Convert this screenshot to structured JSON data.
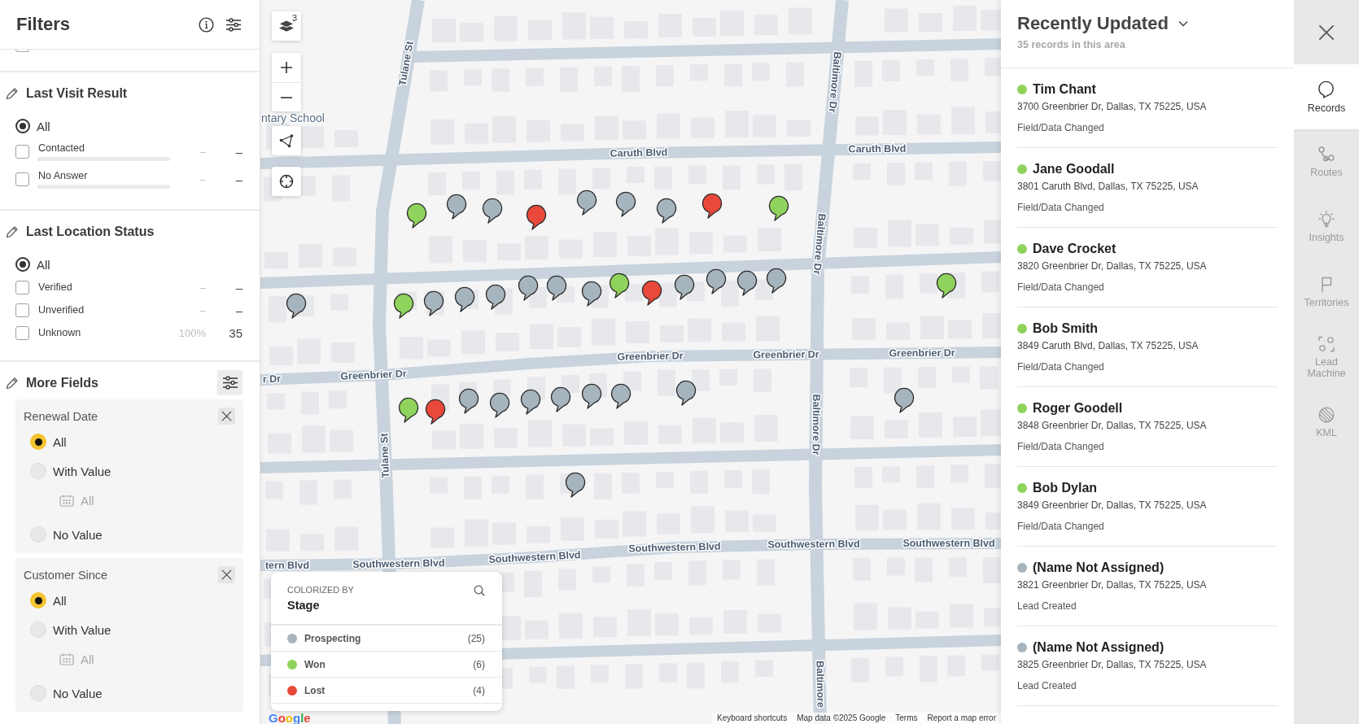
{
  "filters": {
    "title": "Filters",
    "scrolled_checkbox": {
      "checked": false
    },
    "sections": [
      {
        "title": "Last Visit Result",
        "options": [
          {
            "kind": "radio",
            "label": "All",
            "selected": true
          },
          {
            "kind": "checkbox",
            "label": "Contacted",
            "checked": false,
            "level": 0,
            "percent": "–",
            "count": "–"
          },
          {
            "kind": "checkbox",
            "label": "No Answer",
            "checked": false,
            "level": 0,
            "percent": "–",
            "count": "–"
          }
        ]
      },
      {
        "title": "Last Location Status",
        "options": [
          {
            "kind": "radio",
            "label": "All",
            "selected": true
          },
          {
            "kind": "checkbox",
            "label": "Verified",
            "checked": false,
            "percent": "–",
            "count": "–"
          },
          {
            "kind": "checkbox",
            "label": "Unverified",
            "checked": false,
            "percent": "–",
            "count": "–"
          },
          {
            "kind": "checkbox",
            "label": "Unknown",
            "checked": false,
            "percent": "100%",
            "count": "35"
          }
        ]
      }
    ],
    "more_fields": {
      "title": "More Fields",
      "fields": [
        {
          "title": "Renewal Date",
          "options": [
            {
              "label": "All",
              "selected": true
            },
            {
              "label": "With Value",
              "selected": false,
              "date_range": "All"
            },
            {
              "label": "No Value",
              "selected": false
            }
          ]
        },
        {
          "title": "Customer Since",
          "options": [
            {
              "label": "All",
              "selected": true
            },
            {
              "label": "With Value",
              "selected": false,
              "date_range": "All"
            },
            {
              "label": "No Value",
              "selected": false
            }
          ]
        }
      ]
    }
  },
  "map": {
    "layers_count": "3",
    "street_labels": [
      {
        "text": "Tulane St",
        "kind": "street"
      },
      {
        "text": "ntary School",
        "kind": "place"
      },
      {
        "text": "Caruth Blvd",
        "kind": "street"
      },
      {
        "text": "Caruth Blvd",
        "kind": "street"
      },
      {
        "text": "Baltimore Dr",
        "kind": "street"
      },
      {
        "text": "Baltimore Dr",
        "kind": "street"
      },
      {
        "text": "r Dr",
        "kind": "street"
      },
      {
        "text": "Greenbrier Dr",
        "kind": "street"
      },
      {
        "text": "Greenbrier Dr",
        "kind": "street"
      },
      {
        "text": "Greenbrier Dr",
        "kind": "street"
      },
      {
        "text": "Greenbrier Dr",
        "kind": "street"
      },
      {
        "text": "Baltimore Dr",
        "kind": "street"
      },
      {
        "text": "Tulane St",
        "kind": "street"
      },
      {
        "text": "tern Blvd",
        "kind": "street"
      },
      {
        "text": "Southwestern Blvd",
        "kind": "street"
      },
      {
        "text": "Southwestern Blvd",
        "kind": "street"
      },
      {
        "text": "Southwestern Blvd",
        "kind": "street"
      },
      {
        "text": "Southwestern Blvd",
        "kind": "street"
      },
      {
        "text": "Southwestern Blvd",
        "kind": "street"
      },
      {
        "text": "Baltimore",
        "kind": "street"
      }
    ],
    "pins": [
      {
        "color": "#8fd35c"
      },
      {
        "color": "#a6b4be"
      },
      {
        "color": "#a6b4be"
      },
      {
        "color": "#e8493b"
      },
      {
        "color": "#a6b4be"
      },
      {
        "color": "#a6b4be"
      },
      {
        "color": "#a6b4be"
      },
      {
        "color": "#e8493b"
      },
      {
        "color": "#8fd35c"
      },
      {
        "color": "#a6b4be"
      },
      {
        "color": "#8fd35c"
      },
      {
        "color": "#a6b4be"
      },
      {
        "color": "#a6b4be"
      },
      {
        "color": "#a6b4be"
      },
      {
        "color": "#a6b4be"
      },
      {
        "color": "#a6b4be"
      },
      {
        "color": "#a6b4be"
      },
      {
        "color": "#8fd35c"
      },
      {
        "color": "#e8493b"
      },
      {
        "color": "#a6b4be"
      },
      {
        "color": "#a6b4be"
      },
      {
        "color": "#a6b4be"
      },
      {
        "color": "#a6b4be"
      },
      {
        "color": "#8fd35c"
      },
      {
        "color": "#8fd35c"
      },
      {
        "color": "#e8493b"
      },
      {
        "color": "#a6b4be"
      },
      {
        "color": "#a6b4be"
      },
      {
        "color": "#a6b4be"
      },
      {
        "color": "#a6b4be"
      },
      {
        "color": "#a6b4be"
      },
      {
        "color": "#a6b4be"
      },
      {
        "color": "#a6b4be"
      },
      {
        "color": "#a6b4be"
      },
      {
        "color": "#a6b4be"
      }
    ],
    "legend": {
      "caption": "COLORIZED BY",
      "field": "Stage",
      "items": [
        {
          "label": "Prospecting",
          "count": "(25)",
          "color": "#a6b4be"
        },
        {
          "label": "Won",
          "count": "(6)",
          "color": "#8fd35c"
        },
        {
          "label": "Lost",
          "count": "(4)",
          "color": "#e8493b"
        }
      ]
    },
    "logo": "Google",
    "attribution": [
      "Keyboard shortcuts",
      "Map data ©2025 Google",
      "Terms",
      "Report a map error"
    ]
  },
  "records_panel": {
    "title": "Recently Updated",
    "subtitle": "35 records in this area",
    "records": [
      {
        "name": "Tim Chant",
        "address": "3700 Greenbrier Dr, Dallas, TX 75225, USA",
        "activity": "Field/Data Changed",
        "color": "#8fd35c"
      },
      {
        "name": "Jane Goodall",
        "address": "3801 Caruth Blvd, Dallas, TX 75225, USA",
        "activity": "Field/Data Changed",
        "color": "#8fd35c"
      },
      {
        "name": "Dave Crocket",
        "address": "3820 Greenbrier Dr, Dallas, TX 75225, USA",
        "activity": "Field/Data Changed",
        "color": "#8fd35c"
      },
      {
        "name": "Bob Smith",
        "address": "3849 Caruth Blvd, Dallas, TX 75225, USA",
        "activity": "Field/Data Changed",
        "color": "#8fd35c"
      },
      {
        "name": "Roger Goodell",
        "address": "3848 Greenbrier Dr, Dallas, TX 75225, USA",
        "activity": "Field/Data Changed",
        "color": "#8fd35c"
      },
      {
        "name": "Bob Dylan",
        "address": "3849 Greenbrier Dr, Dallas, TX 75225, USA",
        "activity": "Field/Data Changed",
        "color": "#8fd35c"
      },
      {
        "name": "(Name Not Assigned)",
        "address": "3821 Greenbrier Dr, Dallas, TX 75225, USA",
        "activity": "Lead Created",
        "color": "#a6b4be"
      },
      {
        "name": "(Name Not Assigned)",
        "address": "3825 Greenbrier Dr, Dallas, TX 75225, USA",
        "activity": "Lead Created",
        "color": "#a6b4be"
      }
    ]
  },
  "nav_rail": {
    "items": [
      {
        "kind": "records",
        "label": "Records",
        "selected": true
      },
      {
        "kind": "routes",
        "label": "Routes",
        "selected": false
      },
      {
        "kind": "insights",
        "label": "Insights",
        "selected": false
      },
      {
        "kind": "territories",
        "label": "Territories",
        "selected": false
      },
      {
        "kind": "lead_machine",
        "label": "Lead Machine",
        "selected": false
      },
      {
        "kind": "kml",
        "label": "KML",
        "selected": false
      }
    ]
  }
}
